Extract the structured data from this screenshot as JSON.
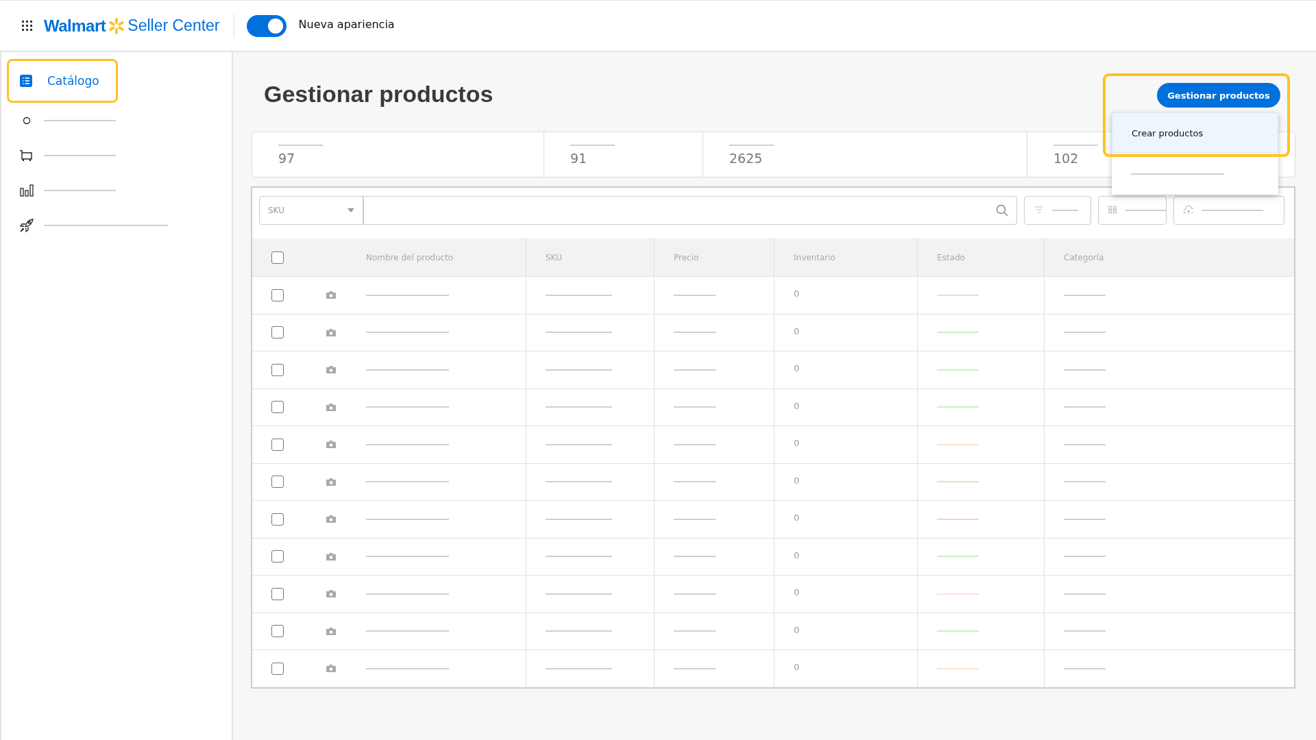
{
  "header": {
    "brand": "Walmart",
    "product": "Seller Center",
    "toggle": {
      "on": true,
      "label": "Nueva apariencia"
    }
  },
  "sidebar": {
    "items": [
      {
        "label": "Catálogo",
        "selected": true,
        "highlighted": true
      },
      {
        "selected": false
      },
      {
        "selected": false
      },
      {
        "selected": false
      },
      {
        "selected": false
      }
    ]
  },
  "page": {
    "title": "Gestionar productos"
  },
  "actions": {
    "button": "Gestionar productos",
    "highlighted": true,
    "menu": [
      {
        "label": "Crear productos",
        "selected": true
      },
      {
        "selected": false
      }
    ]
  },
  "stats": [
    "97",
    "91",
    "2625",
    "102"
  ],
  "toolbar": {
    "search_by": "SKU"
  },
  "table": {
    "all_checked": false,
    "columns": [
      "Nombre del producto",
      "SKU",
      "Precio",
      "Inventario",
      "Estado",
      "Categoría"
    ],
    "rows": [
      {
        "checked": false,
        "inventory": "0",
        "color": "#c8f2c0"
      },
      {
        "checked": false,
        "inventory": "0",
        "color": "#c8f2c0"
      },
      {
        "checked": false,
        "inventory": "0",
        "color": "#c8f2c0"
      },
      {
        "checked": false,
        "inventory": "0",
        "color": "#c8f2c0"
      },
      {
        "checked": false,
        "inventory": "0",
        "color": "#fbe0d6"
      },
      {
        "checked": false,
        "inventory": "0",
        "color": "#c8f2c0"
      },
      {
        "checked": false,
        "inventory": "0",
        "color": "#fbd0c4"
      },
      {
        "checked": false,
        "inventory": "0",
        "color": "#c8f2c0"
      },
      {
        "checked": false,
        "inventory": "0",
        "color": "#fbe6de"
      },
      {
        "checked": false,
        "inventory": "0",
        "color": "#c8f2c0"
      },
      {
        "checked": false,
        "inventory": "0",
        "color": "#fbe0d6"
      }
    ]
  }
}
